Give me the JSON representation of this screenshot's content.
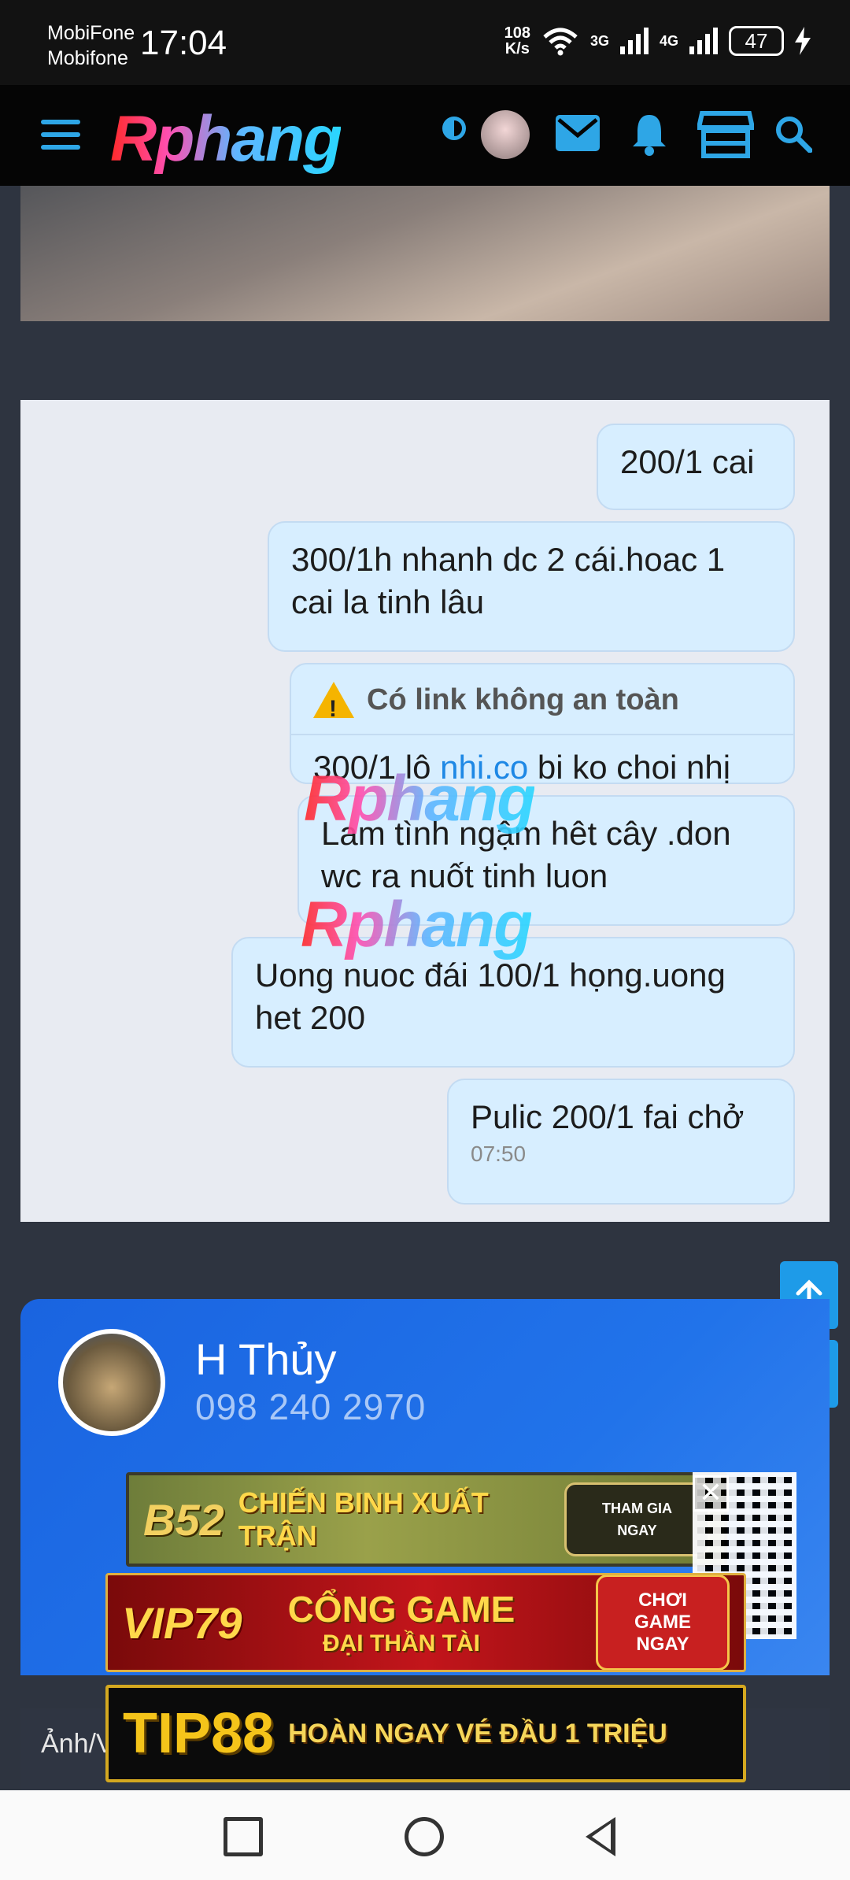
{
  "status_bar": {
    "carrier_line1": "MobiFone",
    "carrier_line2": "Mobifone",
    "time": "17:04",
    "speed_value": "108",
    "speed_unit": "K/s",
    "net1": "3G",
    "net2": "4G",
    "battery": "47"
  },
  "header": {
    "logo_text": "Rphang",
    "icons": [
      "menu-icon",
      "theme-toggle-icon",
      "avatar",
      "mail-icon",
      "bell-icon",
      "store-icon",
      "search-icon"
    ],
    "accent_color": "#2ea6e6"
  },
  "chat": {
    "messages": [
      {
        "text": "200/1 cai"
      },
      {
        "text": "300/1h nhanh dc 2 cái.hoac 1 cai la tinh lâu"
      },
      {
        "warning": "Có link không an toàn",
        "text_before": "300/1 lô ",
        "link": "nhi.co",
        "text_after": " bi ko choi nhị"
      },
      {
        "text": " Lam tình ngậm hêt cây .don wc ra nuốt tinh luon"
      },
      {
        "text": "Uong nuoc đái 100/1 họng.uong het 200"
      },
      {
        "text": "Pulic 200/1 fai chở",
        "time": "07:50"
      }
    ],
    "watermark": "Rphang"
  },
  "scroll_buttons": {
    "up": "↑",
    "down": "↓"
  },
  "contact": {
    "name": "H Thủy",
    "phone": "098 240 2970"
  },
  "ads": {
    "b52_logo": "B52",
    "b52_text": "CHIẾN BINH XUẤT TRẬN",
    "b52_cta": "THAM GIA NGAY",
    "vip_logo": "VIP79",
    "vip_text_line1": "CỔNG GAME",
    "vip_text_line2": "ĐẠI THẦN TÀI",
    "vip_cta": "CHƠI GAME NGAY",
    "tip_logo": "TIP88",
    "tip_text": "HOÀN NGAY VÉ ĐẦU 1 TRIỆU",
    "close": "✕"
  },
  "partial_label": "Ảnh/V"
}
